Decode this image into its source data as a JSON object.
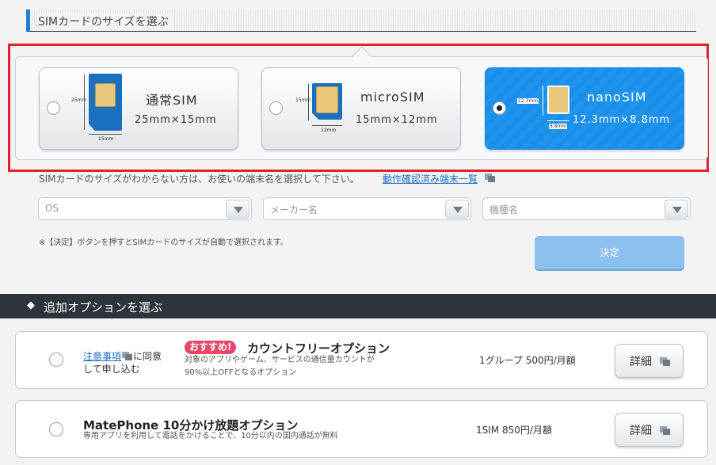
{
  "sim_section": {
    "title": "SIMカードのサイズを選ぶ",
    "options": [
      {
        "name": "通常SIM",
        "size": "25mm×15mm",
        "dim_v": "25mm",
        "dim_h": "15mm",
        "selected": false
      },
      {
        "name": "microSIM",
        "size": "15mm×12mm",
        "dim_v": "15mm",
        "dim_h": "12mm",
        "selected": false
      },
      {
        "name": "nanoSIM",
        "size": "12.3mm×8.8mm",
        "dim_v": "12.3mm",
        "dim_h": "8.8mm",
        "selected": true
      }
    ],
    "help_text": "SIMカードのサイズがわからない方は、お使いの端末名を選択して下さい。",
    "help_link": "動作確認済み端末一覧",
    "selects": [
      {
        "placeholder": "OS"
      },
      {
        "placeholder": "メーカー名"
      },
      {
        "placeholder": "機種名"
      }
    ],
    "note": "※【決定】ボタンを押すとSIMカードのサイズが自動で選択されます。",
    "decide_label": "決定"
  },
  "options_section": {
    "title": "追加オプションを選ぶ",
    "diamond": "◆",
    "items": [
      {
        "consent_link": "注意事項",
        "consent_rest": "に同意して申し込む",
        "badge": "おすすめ!",
        "title": "カウントフリーオプション",
        "desc_1": "対象のアプリやゲーム、サービスの通信量カウントが",
        "desc_2": "90%以上OFFとなるオプション",
        "price": "1グループ 500円/月額",
        "detail_label": "詳細"
      },
      {
        "title": "MatePhone 10分かけ放題オプション",
        "desc_1": "専用アプリを利用して電話をかけることで、10分以内の国内通話が無料",
        "price": "1SIM 850円/月額",
        "detail_label": "詳細"
      }
    ]
  }
}
